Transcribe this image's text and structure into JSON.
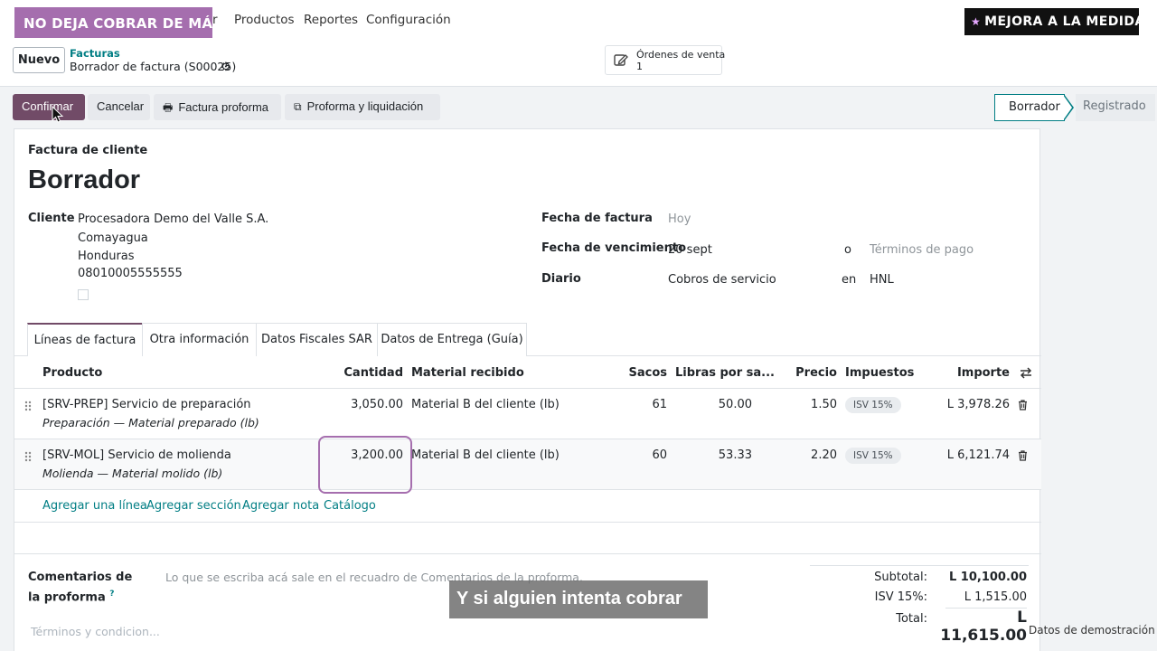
{
  "navbar": {
    "banner": "NO DEJA COBRAR DE MÁS",
    "banner_tail": "r",
    "items": [
      "Productos",
      "Reportes",
      "Configuración"
    ],
    "promo": "MEJORA A LA MEDIDA"
  },
  "control": {
    "new_label": "Nuevo",
    "breadcrumb_parent": "Facturas",
    "breadcrumb_current": "Borrador de factura (S00025)",
    "smart_button": {
      "label": "Órdenes de venta",
      "count": "1"
    }
  },
  "actions": {
    "confirm": "Confirmar",
    "cancel": "Cancelar",
    "proforma": "Factura proforma",
    "proforma_settlement": "Proforma y liquidación"
  },
  "status": {
    "current": "Borrador",
    "next": "Registrado"
  },
  "form": {
    "doc_type": "Factura de cliente",
    "title": "Borrador",
    "customer_label": "Cliente",
    "customer_lines": [
      "Procesadora Demo del Valle S.A.",
      "Comayagua",
      "Honduras",
      "08010005555555"
    ],
    "invoice_date_label": "Fecha de factura",
    "invoice_date_placeholder": "Hoy",
    "due_date_label": "Fecha de vencimiento",
    "due_date": "20 sept",
    "due_or": "o",
    "payment_terms_placeholder": "Términos de pago",
    "journal_label": "Diario",
    "journal": "Cobros de servicio",
    "journal_in": "en",
    "currency": "HNL"
  },
  "tabs": [
    "Líneas de factura",
    "Otra información",
    "Datos Fiscales SAR",
    "Datos de Entrega (Guía)"
  ],
  "table": {
    "headers": {
      "product": "Producto",
      "quantity": "Cantidad",
      "material": "Material recibido",
      "bags": "Sacos",
      "pounds": "Libras por sa...",
      "price": "Precio",
      "taxes": "Impuestos",
      "amount": "Importe"
    },
    "rows": [
      {
        "product": "[SRV-PREP] Servicio de preparación",
        "description": "Preparación — Material preparado (lb)",
        "quantity": "3,050.00",
        "material": "Material B del cliente (lb)",
        "bags": "61",
        "pounds": "50.00",
        "price": "1.50",
        "tax": "ISV 15%",
        "amount": "L 3,978.26"
      },
      {
        "product": "[SRV-MOL] Servicio de molienda",
        "description": "Molienda — Material molido (lb)",
        "quantity": "3,200.00",
        "material": "Material B del cliente (lb)",
        "bags": "60",
        "pounds": "53.33",
        "price": "2.20",
        "tax": "ISV 15%",
        "amount": "L 6,121.74"
      }
    ],
    "add_links": [
      "Agregar una línea",
      "Agregar sección",
      "Agregar nota",
      "Catálogo"
    ]
  },
  "comments": {
    "label": "Comentarios de la proforma",
    "help": "?",
    "placeholder": "Lo que se escriba acá sale en el recuadro de Comentarios de la proforma.",
    "terms_placeholder": "Términos y condicion..."
  },
  "totals": {
    "subtotal_label": "Subtotal:",
    "subtotal": "L 10,100.00",
    "tax_label": "ISV 15%:",
    "tax": "L 1,515.00",
    "total_label": "Total:",
    "total": "L 11,615.00"
  },
  "overlay": {
    "caption": "Y si alguien intenta cobrar",
    "demo_label": "Datos de demostración"
  },
  "colors": {
    "primary": "#714b67",
    "link": "#017e84",
    "banner": "#a56eae",
    "highlight": "#a56eae"
  }
}
